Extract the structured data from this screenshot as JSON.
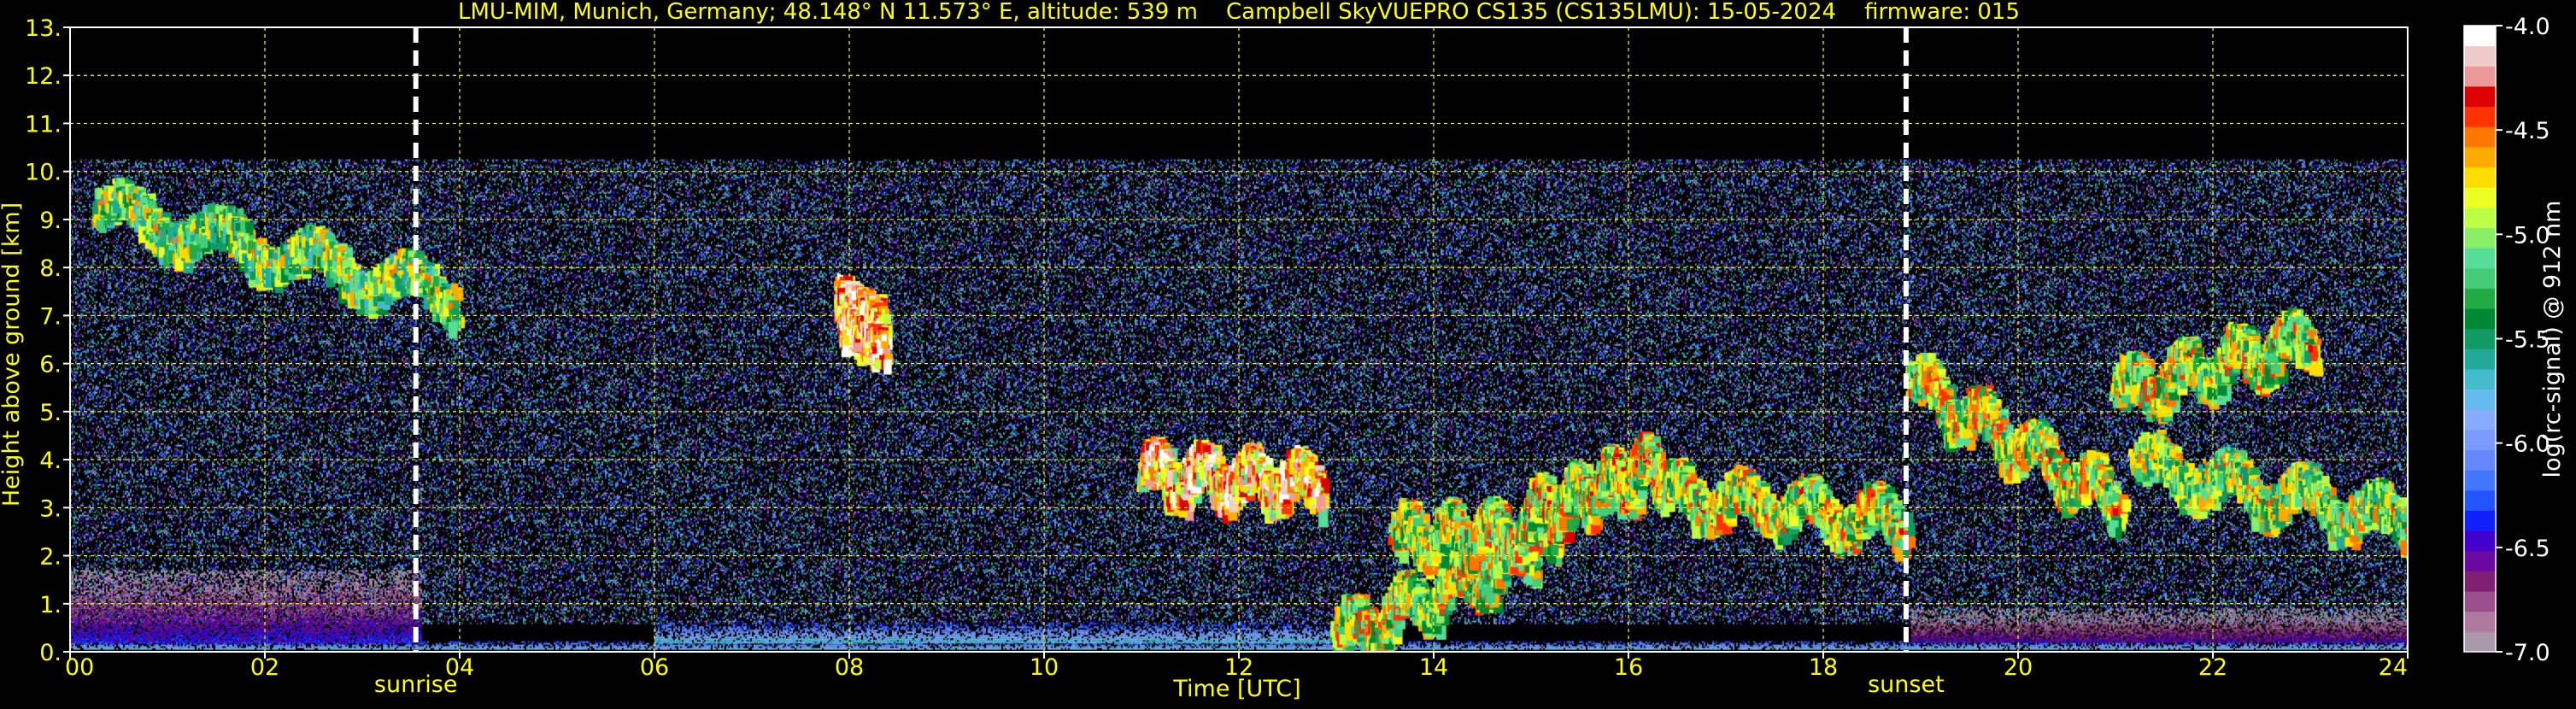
{
  "chart_data": {
    "type": "heatmap",
    "title": "LMU-MIM, Munich, Germany; 48.148° N 11.573° E, altitude: 539 m    Campbell SkyVUEPRO CS135 (CS135LMU): 15-05-2024    firmware: 015",
    "xlabel": "Time [UTC]",
    "ylabel": "Height above ground [km]",
    "xlim": [
      0,
      24
    ],
    "ylim": [
      0,
      13
    ],
    "x_ticks": [
      0,
      2,
      4,
      6,
      8,
      10,
      12,
      14,
      16,
      18,
      20,
      22,
      24
    ],
    "x_tick_labels": [
      "00",
      "02",
      "04",
      "06",
      "08",
      "10",
      "12",
      "14",
      "16",
      "18",
      "20",
      "22",
      "24"
    ],
    "y_ticks": [
      0,
      1,
      2,
      3,
      4,
      5,
      6,
      7,
      8,
      9,
      10,
      11,
      12,
      13
    ],
    "y_tick_labels": [
      "0.",
      "1.",
      "2.",
      "3.",
      "4.",
      "5.",
      "6.",
      "7.",
      "8.",
      "9.",
      "10.",
      "11.",
      "12.",
      "13."
    ],
    "grid": true,
    "grid_color": "#ffff00",
    "text_color": "#ffff00",
    "background": "#000000",
    "colorbar": {
      "label": "log(rc-signal) @ 912 nm",
      "range": [
        -7.0,
        -4.0
      ],
      "ticks": [
        -7.0,
        -6.5,
        -6.0,
        -5.5,
        -5.0,
        -4.5,
        -4.0
      ],
      "tick_labels": [
        "-7.0",
        "-6.5",
        "-6.0",
        "-5.5",
        "-5.0",
        "-4.5",
        "-4.0"
      ],
      "colors": [
        "#aa99aa",
        "#b07aa0",
        "#9a4f8a",
        "#7e1f74",
        "#6a0aa0",
        "#4400cc",
        "#1020ff",
        "#2255ff",
        "#4477ff",
        "#6688ff",
        "#7a9aff",
        "#88aaff",
        "#66bbee",
        "#44bbcc",
        "#22aa99",
        "#119966",
        "#008833",
        "#22aa44",
        "#44cc77",
        "#55dd99",
        "#88ee66",
        "#bbff44",
        "#eeff22",
        "#ffdd00",
        "#ffaa00",
        "#ff7700",
        "#ff3300",
        "#dd0000",
        "#ee9999",
        "#eecccc",
        "#ffffff"
      ]
    },
    "markers": [
      {
        "label": "sunrise",
        "x": 3.55
      },
      {
        "label": "sunset",
        "x": 18.85
      }
    ],
    "features": [
      {
        "kind": "noise",
        "x": [
          0,
          24
        ],
        "y": [
          0.6,
          10.25
        ],
        "level": -6.3
      },
      {
        "kind": "band",
        "x": [
          0,
          24
        ],
        "y": [
          0.05,
          0.22
        ],
        "level": -6.0
      },
      {
        "kind": "band",
        "x": [
          0,
          3.6
        ],
        "y": [
          0.2,
          1.7
        ],
        "level": -6.7
      },
      {
        "kind": "band",
        "x": [
          6,
          13
        ],
        "y": [
          0.2,
          0.6
        ],
        "level": -6.0
      },
      {
        "kind": "band",
        "x": [
          18.9,
          24
        ],
        "y": [
          0.2,
          0.9
        ],
        "level": -6.8
      },
      {
        "kind": "cloud",
        "x": [
          0.3,
          3.9
        ],
        "y": [
          9.3,
          7.5
        ],
        "level": -4.8
      },
      {
        "kind": "cloud",
        "x": [
          7.9,
          8.3
        ],
        "y": [
          7.2,
          6.7
        ],
        "level": -4.0
      },
      {
        "kind": "cloud",
        "x": [
          11.0,
          12.8
        ],
        "y": [
          3.8,
          3.6
        ],
        "level": -4.2
      },
      {
        "kind": "cloud",
        "x": [
          13.0,
          15.0
        ],
        "y": [
          0.4,
          2.2
        ],
        "level": -4.6
      },
      {
        "kind": "cloud",
        "x": [
          13.6,
          15.2
        ],
        "y": [
          2.5,
          2.6
        ],
        "level": -4.6
      },
      {
        "kind": "cloud",
        "x": [
          15.0,
          16.3
        ],
        "y": [
          3.0,
          4.0
        ],
        "level": -4.5
      },
      {
        "kind": "cloud",
        "x": [
          16.3,
          18.8
        ],
        "y": [
          3.4,
          2.8
        ],
        "level": -4.6
      },
      {
        "kind": "cloud",
        "x": [
          18.9,
          21.0
        ],
        "y": [
          5.7,
          3.2
        ],
        "level": -4.6
      },
      {
        "kind": "cloud",
        "x": [
          21.0,
          23.0
        ],
        "y": [
          5.5,
          6.6
        ],
        "level": -4.6
      },
      {
        "kind": "cloud",
        "x": [
          21.2,
          24.0
        ],
        "y": [
          4.0,
          2.8
        ],
        "level": -4.7
      }
    ]
  }
}
